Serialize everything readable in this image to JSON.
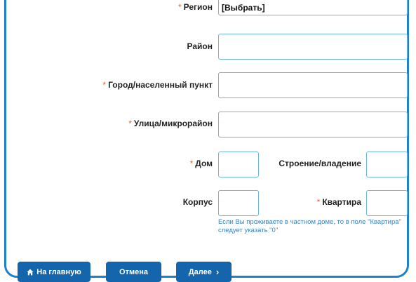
{
  "form": {
    "region": {
      "label": "Регион",
      "value": "[Выбрать]"
    },
    "district": {
      "label": "Район",
      "value": ""
    },
    "city": {
      "label": "Город/населенный пункт",
      "value": ""
    },
    "street": {
      "label": "Улица/микрорайон",
      "value": ""
    },
    "house": {
      "label": "Дом",
      "value": ""
    },
    "building": {
      "label": "Строение/владение",
      "value": ""
    },
    "korpus": {
      "label": "Корпус",
      "value": ""
    },
    "apartment": {
      "label": "Квартира",
      "value": ""
    },
    "required_mark": "*",
    "hint": "Если Вы проживаете в частном доме, то в поле \"Квартира\" следует указать \"0\""
  },
  "buttons": {
    "home": {
      "label": "На главную",
      "icon": "home-icon"
    },
    "cancel": {
      "label": "Отмена"
    },
    "next": {
      "label": "Далее",
      "icon": "chevron-right-icon"
    }
  },
  "colors": {
    "frame": "#1e82c8",
    "button": "#1565ad",
    "required": "#e8632c",
    "field_border": "#6fb4e6",
    "hint": "#3b82c4"
  }
}
